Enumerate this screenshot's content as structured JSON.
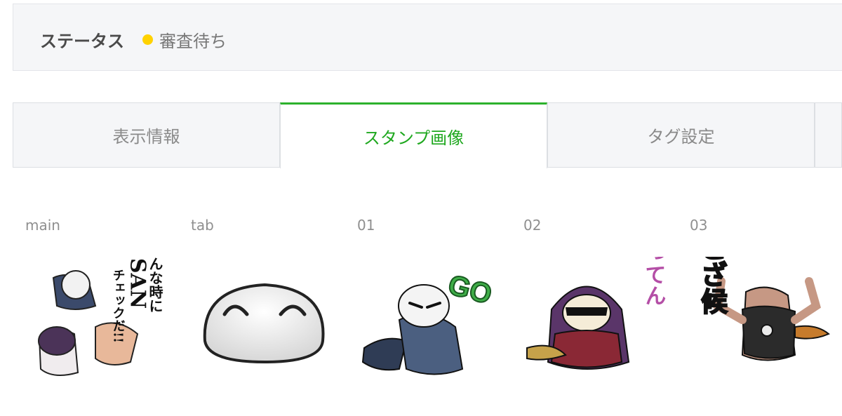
{
  "status": {
    "label": "ステータス",
    "value": "審査待ち",
    "dot_color": "#ffd200"
  },
  "tabs": [
    {
      "label": "表示情報",
      "active": false
    },
    {
      "label": "スタンプ画像",
      "active": true
    },
    {
      "label": "タグ設定",
      "active": false
    }
  ],
  "accent_color": "#2cb22c",
  "stickers": [
    {
      "slot": "main",
      "icon": "group-sticker-image",
      "text_lines": [
        "こんな時に",
        "SAN",
        "チェックだ!!"
      ]
    },
    {
      "slot": "tab",
      "icon": "smiling-blob-sticker-image"
    },
    {
      "slot": "01",
      "icon": "go-character-sticker-image",
      "text": "GO"
    },
    {
      "slot": "02",
      "icon": "hooded-figure-sticker-image",
      "text": "ばってん"
    },
    {
      "slot": "03",
      "icon": "muscle-man-sticker-image",
      "text": "ござ候"
    }
  ]
}
